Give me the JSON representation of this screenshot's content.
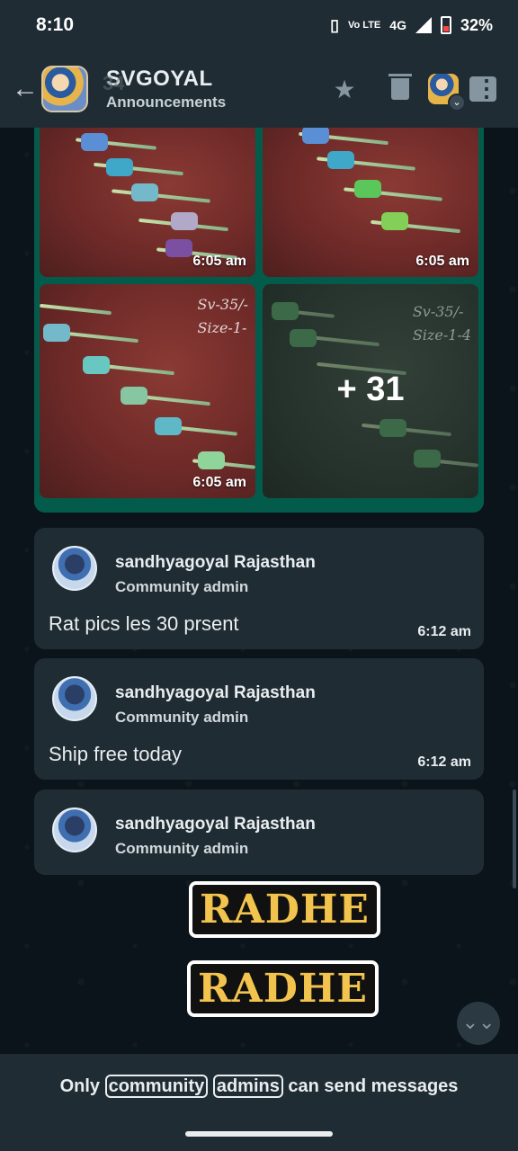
{
  "status": {
    "time": "8:10",
    "network": "4G",
    "volte": "Vo LTE",
    "battery": "32%"
  },
  "header": {
    "title": "SVGOYAL",
    "subtitle": "Announcements",
    "badge_count": "34"
  },
  "media": {
    "tiles": [
      {
        "time": "6:05 am",
        "note": ""
      },
      {
        "time": "6:05 am",
        "note": ""
      },
      {
        "time": "6:05 am",
        "note": "Sv-35/-\nSize-1-"
      },
      {
        "time": "",
        "note": "Sv-35/-\nSize-1-4",
        "more": "+ 31"
      }
    ]
  },
  "messages": [
    {
      "sender": "sandhyagoyal Rajasthan",
      "role": "Community admin",
      "text": "Rat pics les 30 prsent",
      "time": "6:12 am"
    },
    {
      "sender": "sandhyagoyal Rajasthan",
      "role": "Community admin",
      "text": "Ship free today",
      "time": "6:12 am"
    },
    {
      "sender": "sandhyagoyal Rajasthan",
      "role": "Community admin",
      "text": "",
      "time": ""
    }
  ],
  "sticker": {
    "line1": "RADHE",
    "line2": "RADHE"
  },
  "footer": {
    "prefix": "Only ",
    "highlight1": "community",
    "space": " ",
    "highlight2": "admins",
    "suffix": " can send messages"
  }
}
